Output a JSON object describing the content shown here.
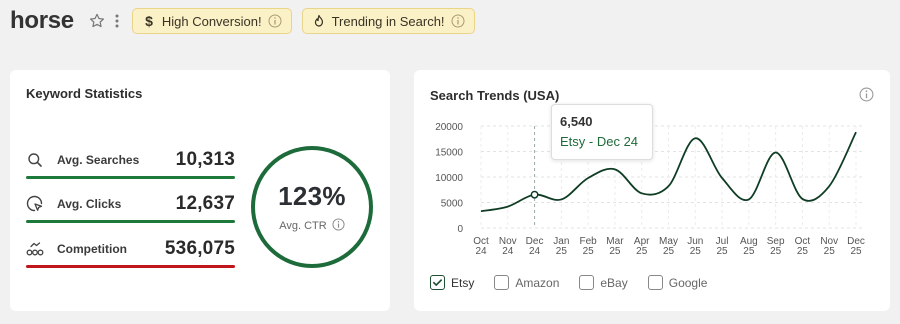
{
  "keyword": "horse",
  "badges": [
    {
      "label": "High Conversion!",
      "icon": "dollar-icon"
    },
    {
      "label": "Trending in Search!",
      "icon": "flame-icon"
    }
  ],
  "keyword_statistics": {
    "title": "Keyword Statistics",
    "rows": [
      {
        "label": "Avg. Searches",
        "value": "10,313",
        "bar_color": "#1d7a3a",
        "icon": "search-icon"
      },
      {
        "label": "Avg. Clicks",
        "value": "12,637",
        "bar_color": "#1d7a3a",
        "icon": "pointer-click-icon"
      },
      {
        "label": "Competition",
        "value": "536,075",
        "bar_color": "#c0151b",
        "icon": "competition-icon"
      }
    ],
    "ctr": {
      "value": "123%",
      "label": "Avg. CTR"
    }
  },
  "search_trends": {
    "title": "Search Trends (USA)",
    "tooltip": {
      "value": "6,540",
      "series": "Etsy - Dec 24"
    },
    "legend": [
      {
        "label": "Etsy",
        "checked": true
      },
      {
        "label": "Amazon",
        "checked": false
      },
      {
        "label": "eBay",
        "checked": false
      },
      {
        "label": "Google",
        "checked": false
      }
    ]
  },
  "chart_data": {
    "type": "line",
    "title": "Search Trends (USA)",
    "categories": [
      [
        "Oct",
        "24"
      ],
      [
        "Nov",
        "24"
      ],
      [
        "Dec",
        "24"
      ],
      [
        "Jan",
        "25"
      ],
      [
        "Feb",
        "25"
      ],
      [
        "Mar",
        "25"
      ],
      [
        "Apr",
        "25"
      ],
      [
        "May",
        "25"
      ],
      [
        "Jun",
        "25"
      ],
      [
        "Jul",
        "25"
      ],
      [
        "Aug",
        "25"
      ],
      [
        "Sep",
        "25"
      ],
      [
        "Oct",
        "25"
      ],
      [
        "Nov",
        "25"
      ],
      [
        "Dec",
        "25"
      ]
    ],
    "y_ticks": [
      "20000",
      "15000",
      "10000",
      "5000",
      "0"
    ],
    "ylim": [
      0,
      20000
    ],
    "grid": true,
    "highlight_index": 2,
    "series": [
      {
        "name": "Etsy",
        "color": "#0f3d24",
        "values": [
          3300,
          4200,
          6540,
          5600,
          9800,
          11500,
          6800,
          8200,
          17600,
          9800,
          5600,
          14800,
          5700,
          8200,
          18800
        ]
      }
    ]
  },
  "colors": {
    "accent": "#1d6b3a",
    "danger": "#c0151b",
    "badge_bg": "#fbf1c7"
  }
}
